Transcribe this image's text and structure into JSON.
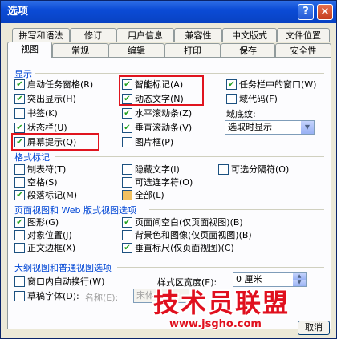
{
  "window": {
    "title": "选项",
    "help_glyph": "?",
    "close_glyph": "×"
  },
  "tabs_row1": [
    "拼写和语法",
    "修订",
    "用户信息",
    "兼容性",
    "中文版式",
    "文件位置"
  ],
  "tabs_row2": [
    "视图",
    "常规",
    "编辑",
    "打印",
    "保存",
    "安全性"
  ],
  "active_tab": "视图",
  "sections": {
    "display": "显示",
    "format_marks": "格式标记",
    "page_web": "页面视图和 Web 版式视图选项",
    "outline": "大纲视图和普通视图选项"
  },
  "display": {
    "col1": [
      {
        "label": "启动任务窗格(R)",
        "checked": true
      },
      {
        "label": "突出显示(H)",
        "checked": true
      },
      {
        "label": "书签(K)",
        "checked": false
      },
      {
        "label": "状态栏(U)",
        "checked": true
      },
      {
        "label": "屏幕提示(Q)",
        "checked": true
      }
    ],
    "col2": [
      {
        "label": "智能标记(A)",
        "checked": true
      },
      {
        "label": "动态文字(N)",
        "checked": true
      },
      {
        "label": "水平滚动条(Z)",
        "checked": true
      },
      {
        "label": "垂直滚动条(V)",
        "checked": true
      },
      {
        "label": "图片框(P)",
        "checked": false
      }
    ],
    "col3": [
      {
        "label": "任务栏中的窗口(W)",
        "checked": true
      },
      {
        "label": "域代码(F)",
        "checked": false
      }
    ],
    "field_shading_label": "域底纹:",
    "field_shading_value": "选取时显示"
  },
  "format_marks": {
    "col1": [
      {
        "label": "制表符(T)",
        "checked": false
      },
      {
        "label": "空格(S)",
        "checked": false
      },
      {
        "label": "段落标记(M)",
        "checked": true
      }
    ],
    "col2": [
      {
        "label": "隐藏文字(I)",
        "checked": false
      },
      {
        "label": "可选连字符(O)",
        "checked": false
      },
      {
        "label": "全部(L)",
        "checked": false
      }
    ],
    "col3": [
      {
        "label": "可选分隔符(O)",
        "checked": false
      }
    ]
  },
  "page_web": {
    "col1": [
      {
        "label": "图形(G)",
        "checked": true
      },
      {
        "label": "对象位置(J)",
        "checked": false
      },
      {
        "label": "正文边框(X)",
        "checked": false
      }
    ],
    "col2": [
      {
        "label": "页面间空白(仅页面视图)(B)",
        "checked": true
      },
      {
        "label": "背景色和图像(仅页面视图)(B)",
        "checked": false
      },
      {
        "label": "垂直标尺(仅页面视图)(C)",
        "checked": true
      }
    ]
  },
  "outline": {
    "wrap_label": "窗口内自动换行(W)",
    "draft_label": "草稿字体(D):",
    "name_label": "名称(E):",
    "font_value": "宋体",
    "style_width_label": "样式区宽度(E):",
    "style_width_value": "0 厘米"
  },
  "buttons": {
    "ok": "取消"
  },
  "watermark": {
    "title": "技术员联盟",
    "url": "www.jsgho.com"
  },
  "colors": {
    "highlight": "#e0141e",
    "title_bar": "#0b4bd6",
    "section_text": "#0046d5"
  }
}
